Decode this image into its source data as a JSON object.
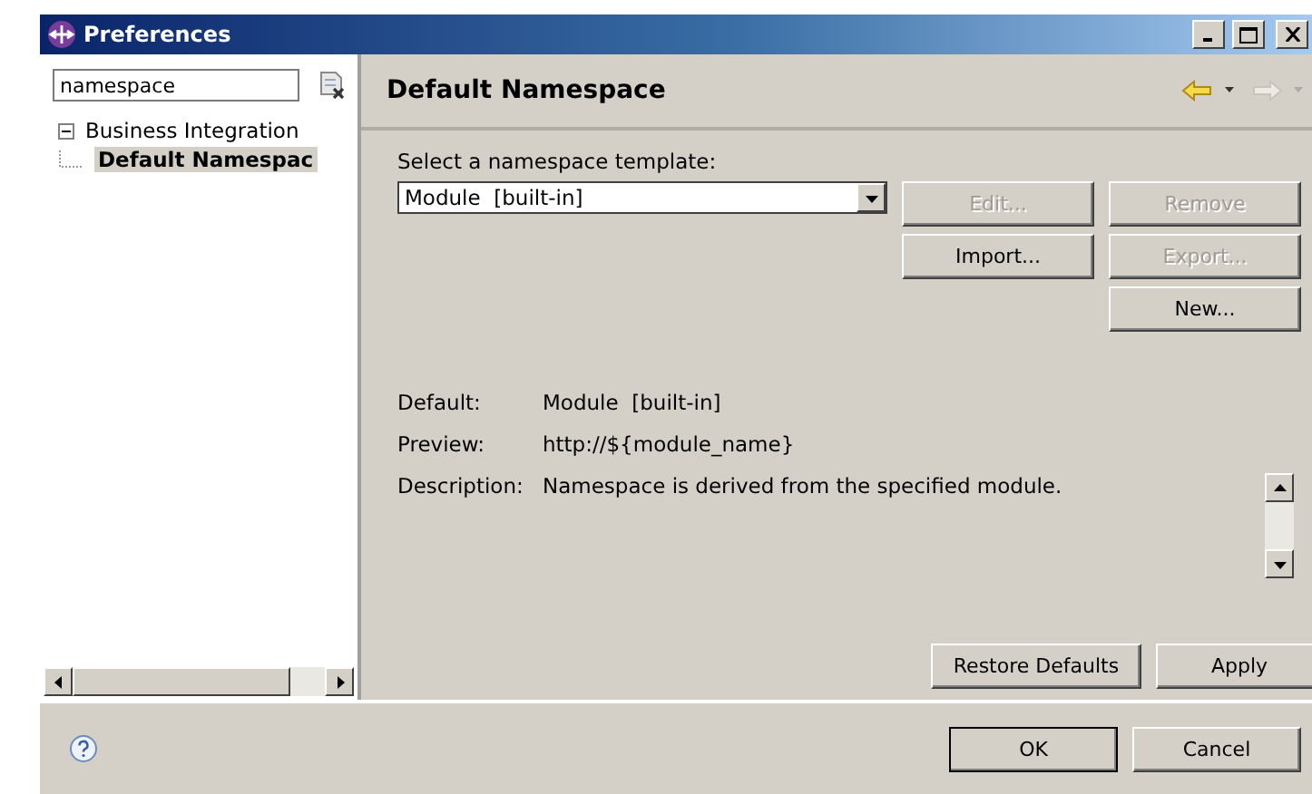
{
  "window": {
    "title": "Preferences"
  },
  "filter": {
    "value": "namespace"
  },
  "tree": [
    {
      "label": "Business Integration",
      "expanded": true,
      "selected": false,
      "children": [
        {
          "label": "Default Namespac",
          "selected": true
        }
      ]
    }
  ],
  "page": {
    "title": "Default Namespace",
    "template_label": "Select a namespace template:",
    "template_value": "Module  [built-in]",
    "buttons": [
      {
        "label": "Edit...",
        "disabled": true
      },
      {
        "label": "Remove",
        "disabled": true
      },
      {
        "label": "Import...",
        "disabled": false
      },
      {
        "label": "Export...",
        "disabled": true
      },
      {
        "label": "New...",
        "disabled": false
      }
    ],
    "details": [
      {
        "label": "Default:",
        "value": "Module  [built-in]"
      },
      {
        "label": "Preview:",
        "value": "http://${module_name}"
      },
      {
        "label": "Description:",
        "value": "Namespace is derived from the specified module."
      }
    ],
    "actions": [
      "Restore Defaults",
      "Apply"
    ]
  },
  "footer_buttons": [
    "OK",
    "Cancel"
  ]
}
